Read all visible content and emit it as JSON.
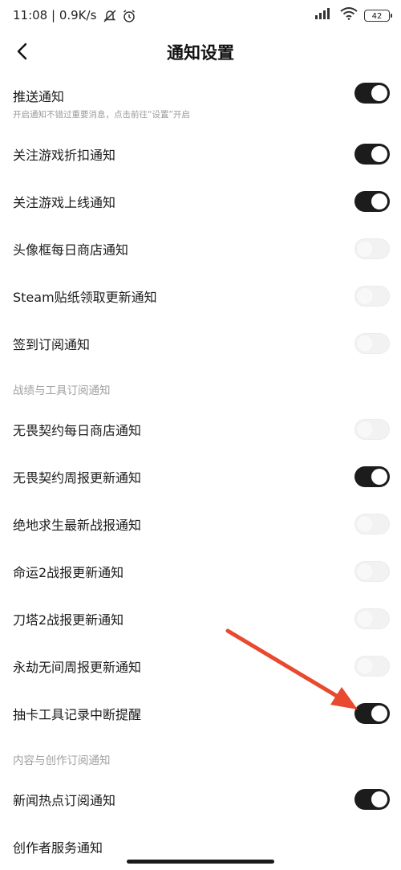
{
  "status_bar": {
    "time": "11:08 | 0.9K/s",
    "battery": "42"
  },
  "header": {
    "title": "通知设置"
  },
  "top_items": [
    {
      "label": "推送通知",
      "subtitle": "开启通知不错过重要消息，点击前往“设置”开启",
      "on": true
    },
    {
      "label": "关注游戏折扣通知",
      "on": true
    },
    {
      "label": "关注游戏上线通知",
      "on": true
    },
    {
      "label": "头像框每日商店通知",
      "on": false
    },
    {
      "label": "Steam贴纸领取更新通知",
      "on": false
    },
    {
      "label": "签到订阅通知",
      "on": false
    }
  ],
  "section1": {
    "title": "战绩与工具订阅通知",
    "items": [
      {
        "label": "无畏契约每日商店通知",
        "on": false
      },
      {
        "label": "无畏契约周报更新通知",
        "on": true
      },
      {
        "label": "绝地求生最新战报通知",
        "on": false
      },
      {
        "label": "命运2战报更新通知",
        "on": false
      },
      {
        "label": "刀塔2战报更新通知",
        "on": false
      },
      {
        "label": "永劫无间周报更新通知",
        "on": false
      },
      {
        "label": "抽卡工具记录中断提醒",
        "on": true
      }
    ]
  },
  "section2": {
    "title": "内容与创作订阅通知",
    "items": [
      {
        "label": "新闻热点订阅通知",
        "on": true
      },
      {
        "label": "创作者服务通知",
        "on": null
      }
    ]
  },
  "colors": {
    "toggle_on": "#1c1c1c",
    "toggle_off": "#f2f2f2",
    "annotation_arrow": "#e8492f"
  }
}
